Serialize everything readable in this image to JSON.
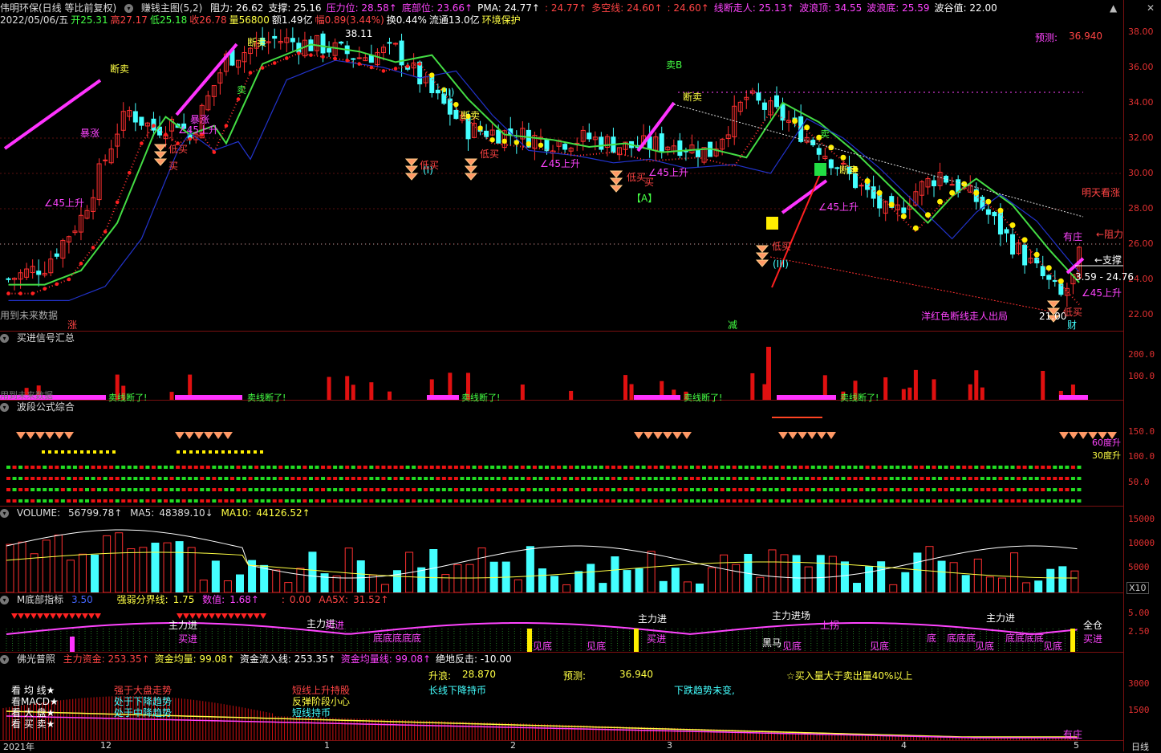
{
  "top_bar": {
    "stock": "伟明环保(日线 等比前复权)",
    "indicator": "赚钱主图(5,2)",
    "items": [
      {
        "label": "阻力:",
        "value": "26.62",
        "color": "#ffffff"
      },
      {
        "label": "支撑:",
        "value": "25.16",
        "color": "#ffffff"
      },
      {
        "label": "压力位:",
        "value": "28.58↑",
        "color": "#ff44ff"
      },
      {
        "label": "底部位:",
        "value": "23.66↑",
        "color": "#ff44ff"
      },
      {
        "label": "PMA:",
        "value": "24.77↑",
        "color": "#ffffff"
      },
      {
        "label": ":",
        "value": "24.77↑",
        "color": "#ff4444"
      },
      {
        "label": "多空线:",
        "value": "24.60↑",
        "color": "#ff4444"
      },
      {
        "label": ":",
        "value": "24.60↑",
        "color": "#ff4444"
      },
      {
        "label": "线断走人:",
        "value": "25.13↑",
        "color": "#ff44ff"
      },
      {
        "label": "波浪顶:",
        "value": "34.55",
        "color": "#ff44ff"
      },
      {
        "label": "波浪底:",
        "value": "25.59",
        "color": "#ff44ff"
      },
      {
        "label": "波谷值:",
        "value": "22.00",
        "color": "#ffffff"
      }
    ],
    "line2": [
      {
        "text": "2022/05/06/五",
        "color": "#dddddd"
      },
      {
        "text": "开25.31",
        "color": "#44ff44"
      },
      {
        "text": "高27.17",
        "color": "#ff4444"
      },
      {
        "text": "低25.18",
        "color": "#44ff44"
      },
      {
        "text": "收26.78",
        "color": "#ff4444"
      },
      {
        "text": "量56800",
        "color": "#ffff44"
      },
      {
        "text": "额1.49亿",
        "color": "#ffffff"
      },
      {
        "text": "幅0.89(3.44%)",
        "color": "#ff4444"
      },
      {
        "text": "换0.44%",
        "color": "#ffffff"
      },
      {
        "text": "流通13.0亿",
        "color": "#ffffff"
      },
      {
        "text": "环境保护",
        "color": "#ffff44"
      }
    ]
  },
  "main_chart": {
    "price_ticks": [
      "38.00",
      "36.00",
      "34.00",
      "32.00",
      "30.00",
      "28.00",
      "26.00",
      "24.00",
      "22.00"
    ],
    "annotations": [
      {
        "text": "断卖",
        "color": "#ffff44"
      },
      {
        "text": "暴涨",
        "color": "#ff44ff"
      },
      {
        "text": "∠45上升",
        "color": "#ff44ff"
      },
      {
        "text": "低买",
        "color": "#ff4444"
      },
      {
        "text": "买",
        "color": "#ff4444"
      },
      {
        "text": "卖",
        "color": "#44ff44"
      },
      {
        "text": "38.11",
        "color": "#ffffff"
      },
      {
        "text": "(II)",
        "color": "#44ffff"
      },
      {
        "text": "(I)",
        "color": "#44ffff"
      },
      {
        "text": "卖B",
        "color": "#44ff44"
      },
      {
        "text": "【A】",
        "color": "#44ff44"
      },
      {
        "text": "(III)",
        "color": "#44ffff"
      },
      {
        "text": "预测:",
        "color": "#ff44ff"
      },
      {
        "text": "36.940",
        "color": "#ff4444"
      },
      {
        "text": "明天看涨",
        "color": "#ff4444"
      },
      {
        "text": "←阻力",
        "color": "#ff4444"
      },
      {
        "text": "←支撑",
        "color": "#ffffff"
      },
      {
        "text": "有庄",
        "color": "#ff44ff"
      },
      {
        "text": "洋红色断线走人出局",
        "color": "#ff44ff"
      },
      {
        "text": "用到未来数据",
        "color": "#aaaaaa"
      },
      {
        "text": "涨",
        "color": "#ff4444"
      },
      {
        "text": "减",
        "color": "#44ff44"
      },
      {
        "text": "财",
        "color": "#44ffff"
      },
      {
        "text": "21.00",
        "color": "#ffffff"
      },
      {
        "text": "3.59 - 24.76",
        "color": "#ffffff"
      }
    ]
  },
  "panel_signal": {
    "title": "买进信号汇总",
    "ticks": [
      "200.0",
      "100.0"
    ],
    "labels": [
      "卖线断了!",
      "卖线断了!",
      "卖线断了!",
      "卖线断了!"
    ],
    "future": "用到未来数据"
  },
  "panel_wave": {
    "title": "波段公式综合",
    "ticks": [
      "150.0",
      "100.0",
      "50.0"
    ],
    "labels": [
      "60度升",
      "30度升"
    ]
  },
  "panel_volume": {
    "title": "VOLUME:",
    "value": "56799.78↑",
    "ma5_label": "MA5:",
    "ma5": "48389.10↓",
    "ma10_label": "MA10:",
    "ma10": "44126.52↑",
    "ticks": [
      "15000",
      "10000",
      "5000"
    ],
    "unit": "X10"
  },
  "panel_mbottom": {
    "title": "M底部指标",
    "v1": "3.50",
    "strength_label": "强弱分界线:",
    "strength": "1.75",
    "value_label": "数值:",
    "value": "1.68↑",
    "colon": ":",
    "v2": "0.00",
    "aa5_label": "AA5X:",
    "aa5": "31.52↑",
    "ticks": [
      "5.00",
      "2.50"
    ],
    "labels": [
      "主力进",
      "买进",
      "主力进",
      "买进",
      "底底底底底",
      "见底",
      "见底",
      "买进",
      "主力进场",
      "上拐",
      "黑马",
      "见底",
      "见底",
      "底",
      "底底底",
      "见底",
      "底底底底",
      "见底",
      "主力进",
      "全仓",
      "买进",
      "主力进"
    ]
  },
  "panel_buddha": {
    "title": "佛光普照",
    "items": [
      {
        "label": "主力资金:",
        "value": "253.35↑",
        "color": "#ff4444"
      },
      {
        "label": "资金均量:",
        "value": "99.08↑",
        "color": "#ffff44"
      },
      {
        "label": "资金流入线:",
        "value": "253.35↑",
        "color": "#ffffff"
      },
      {
        "label": "资金均量线:",
        "value": "99.08↑",
        "color": "#ff44ff"
      },
      {
        "label": "绝地反击:",
        "value": "-10.00",
        "color": "#ffffff"
      }
    ],
    "rise_label": "升浪:",
    "rise": "28.870",
    "forecast_label": "预测:",
    "forecast": "36.940",
    "note": "☆买入量大于卖出量40%以上",
    "left_list": [
      "看 均 线★",
      "看MACD★",
      "看 大 盘★",
      "看 买 卖★"
    ],
    "mid_list": [
      "强于大盘走势",
      "处于下降趋势",
      "处于中降趋势"
    ],
    "right_list": [
      "短线上升持股",
      "反弹阶段小心",
      "短线持币"
    ],
    "long_line": "长线下降持币",
    "trend": "下跌趋势未变,",
    "ticks": [
      "3000",
      "1500"
    ],
    "bottom_label": "有庄"
  },
  "x_axis": {
    "labels": [
      "2021年",
      "12",
      "1",
      "2",
      "3",
      "4",
      "5"
    ],
    "mode": "日线"
  }
}
